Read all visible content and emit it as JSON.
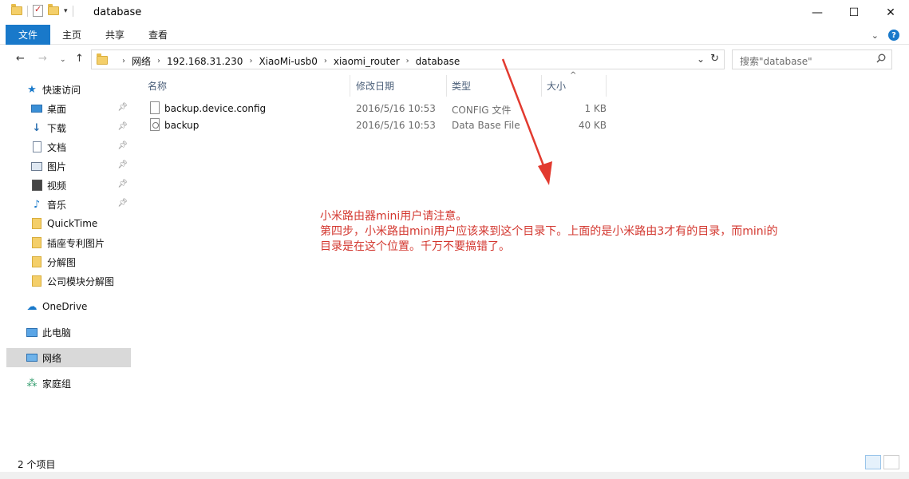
{
  "window": {
    "title": "database",
    "controls": {
      "minimize": "—",
      "maximize": "☐",
      "close": "✕"
    }
  },
  "ribbon": {
    "tabs": [
      "文件",
      "主页",
      "共享",
      "查看"
    ]
  },
  "nav": {
    "breadcrumb": [
      "网络",
      "192.168.31.230",
      "XiaoMi-usb0",
      "xiaomi_router",
      "database"
    ],
    "search_placeholder": "搜索\"database\""
  },
  "sidebar": {
    "quick_access": "快速访问",
    "items": [
      "桌面",
      "下载",
      "文档",
      "图片",
      "视频",
      "音乐",
      "QuickTime",
      "插座专利图片",
      "分解图",
      "公司模块分解图"
    ],
    "onedrive": "OneDrive",
    "this_pc": "此电脑",
    "network": "网络",
    "homegroup": "家庭组"
  },
  "table": {
    "columns": [
      "名称",
      "修改日期",
      "类型",
      "大小"
    ],
    "rows": [
      {
        "name": "backup.device.config",
        "date": "2016/5/16 10:53",
        "type": "CONFIG 文件",
        "size": "1 KB",
        "icon": "file-icon"
      },
      {
        "name": "backup",
        "date": "2016/5/16 10:53",
        "type": "Data Base File",
        "size": "40 KB",
        "icon": "database-file-icon"
      }
    ]
  },
  "annotation": {
    "line1": "小米路由器mini用户请注意。",
    "line2": "第四步，小米路由mini用户应该来到这个目录下。上面的是小米路由3才有的目录，而mini的",
    "line3": "目录是在这个位置。千万不要搞错了。",
    "color": "#d3372f"
  },
  "status": {
    "item_count": "2 个项目"
  }
}
